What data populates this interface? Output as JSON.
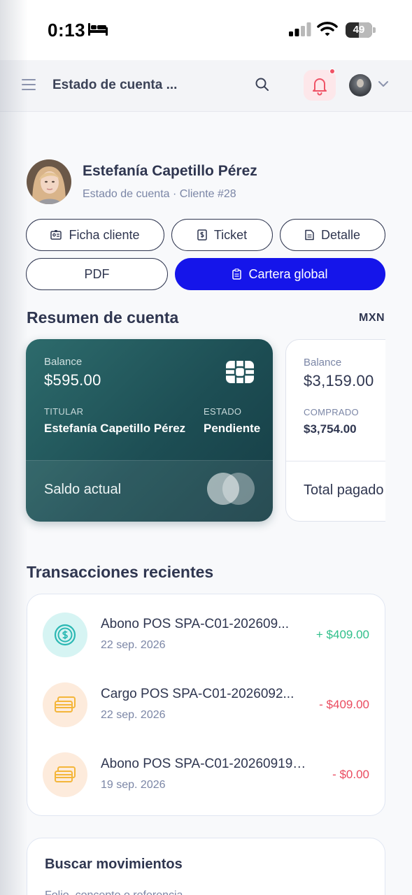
{
  "status_bar": {
    "time": "0:13",
    "battery": "49"
  },
  "header": {
    "title": "Estado de cuenta ..."
  },
  "profile": {
    "name": "Estefanía Capetillo Pérez",
    "subtitle": "Estado de cuenta · Cliente #28"
  },
  "actions": {
    "ficha": "Ficha cliente",
    "ticket": "Ticket",
    "detalle": "Detalle",
    "pdf": "PDF",
    "cartera": "Cartera global"
  },
  "resumen": {
    "title": "Resumen de cuenta",
    "currency": "MXN",
    "card_main": {
      "balance_label": "Balance",
      "balance": "$595.00",
      "titular_label": "TITULAR",
      "titular": "Estefanía Capetillo Pérez",
      "estado_label": "ESTADO",
      "estado": "Pendiente",
      "footer": "Saldo actual"
    },
    "card_second": {
      "balance_label": "Balance",
      "balance": "$3,159.00",
      "comprado_label": "COMPRADO",
      "comprado": "$3,754.00",
      "footer": "Total pagado"
    }
  },
  "transactions": {
    "title": "Transacciones recientes",
    "items": [
      {
        "name": "Abono POS SPA-C01-202609...",
        "date": "22 sep. 2026",
        "amount": "+ $409.00",
        "icon": "dollar-coin-icon"
      },
      {
        "name": "Cargo POS SPA-C01-2026092...",
        "date": "22 sep. 2026",
        "amount": "- $409.00",
        "icon": "cards-icon"
      },
      {
        "name": "Abono POS SPA-C01-20260919-...",
        "date": "19 sep. 2026",
        "amount": "- $0.00",
        "icon": "cards-icon"
      }
    ]
  },
  "search_movements": {
    "title": "Buscar movimientos",
    "subtitle": "Folio, concepto o referencia"
  },
  "colors": {
    "primary": "#1515ea",
    "card_teal": "#1d4e54",
    "positive": "#2fbf8a",
    "negative": "#ea4b5f"
  }
}
